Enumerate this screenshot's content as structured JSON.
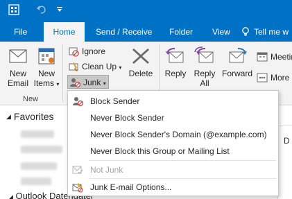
{
  "colors": {
    "brand": "#0072c6",
    "ribbon_bg": "#f3f3f3",
    "junk_pressed": "#c8c8c8",
    "disabled_text": "#a6a6a6"
  },
  "titlebar": {
    "icons": [
      "outlook-app-icon",
      "undo-icon",
      "customize-qat-icon"
    ]
  },
  "tabs": [
    {
      "label": "File"
    },
    {
      "label": "Home"
    },
    {
      "label": "Send / Receive"
    },
    {
      "label": "Folder"
    },
    {
      "label": "View"
    },
    {
      "label": "Tell me w"
    }
  ],
  "ribbon": {
    "new_group": {
      "new_email": "New\nEmail",
      "new_items": "New\nItems",
      "group_label": "New"
    },
    "delete_group": {
      "ignore": "Ignore",
      "clean_up": "Clean Up",
      "junk": "Junk",
      "delete": "Delete"
    },
    "respond_group": {
      "reply": "Reply",
      "reply_all": "Reply\nAll",
      "forward": "Forward",
      "meeting": "Meetin",
      "more": "More"
    }
  },
  "leftpane": {
    "favorites": "Favorites",
    "outlook_data": "Outlook Datendatei"
  },
  "rightstrip": {
    "letter": "D"
  },
  "junk_menu": {
    "items": [
      {
        "label": "Block Sender",
        "icon": "block-sender-icon",
        "enabled": true
      },
      {
        "label": "Never Block Sender",
        "icon": "",
        "enabled": true
      },
      {
        "label": "Never Block Sender's Domain (@example.com)",
        "icon": "",
        "enabled": true
      },
      {
        "label": "Never Block this Group or Mailing List",
        "icon": "",
        "enabled": true
      },
      {
        "label": "Not Junk",
        "icon": "not-junk-icon",
        "enabled": false
      },
      {
        "label": "Junk E-mail Options...",
        "icon": "junk-options-icon",
        "enabled": true
      }
    ]
  }
}
